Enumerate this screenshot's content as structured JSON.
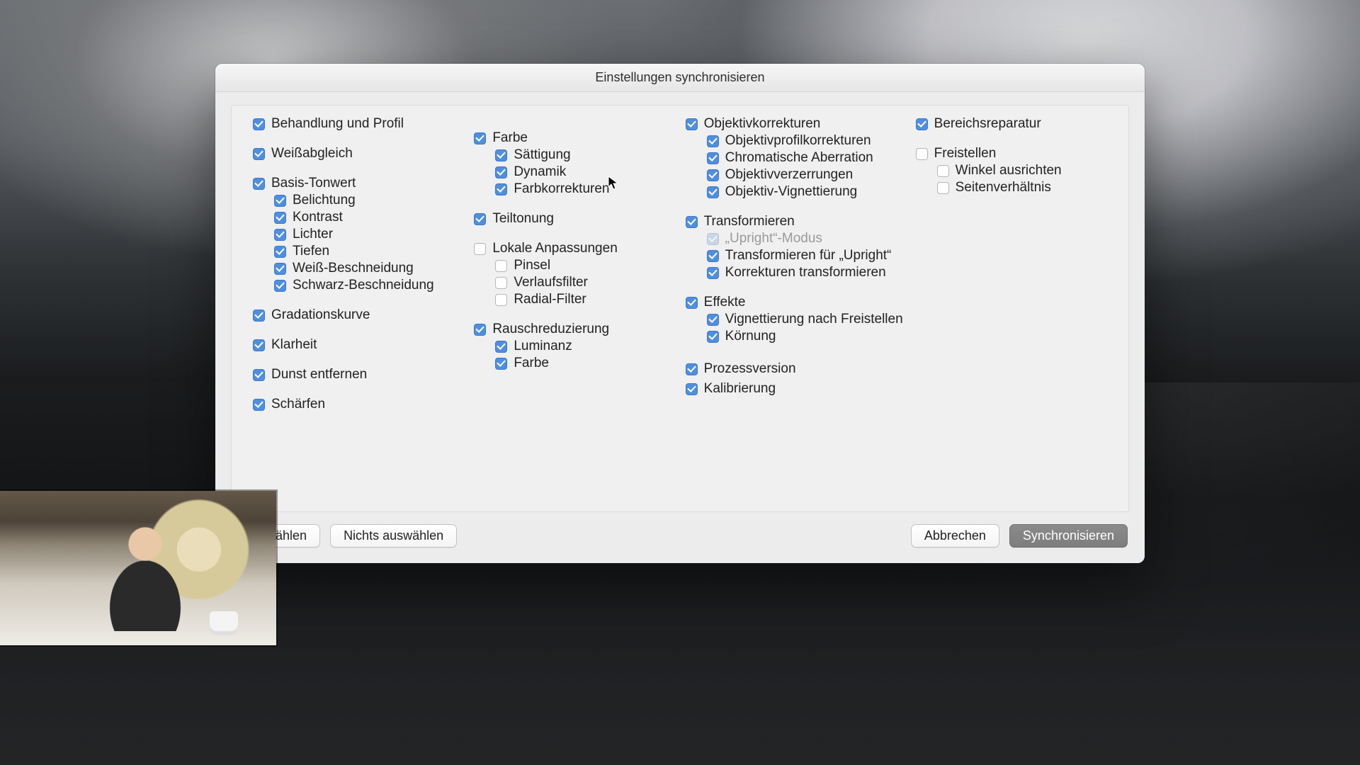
{
  "dialog": {
    "title": "Einstellungen synchronisieren",
    "buttons": {
      "select_all": "auswählen",
      "select_none": "Nichts auswählen",
      "cancel": "Abbrechen",
      "sync": "Synchronisieren"
    }
  },
  "col1": {
    "treatment": {
      "checked": true,
      "label": "Behandlung und Profil"
    },
    "wb": {
      "checked": true,
      "label": "Weißabgleich"
    },
    "basic": {
      "checked": true,
      "label": "Basis-Tonwert",
      "children": [
        {
          "checked": true,
          "label": "Belichtung"
        },
        {
          "checked": true,
          "label": "Kontrast"
        },
        {
          "checked": true,
          "label": "Lichter"
        },
        {
          "checked": true,
          "label": "Tiefen"
        },
        {
          "checked": true,
          "label": "Weiß-Beschneidung"
        },
        {
          "checked": true,
          "label": "Schwarz-Beschneidung"
        }
      ]
    },
    "curve": {
      "checked": true,
      "label": "Gradationskurve"
    },
    "clarity": {
      "checked": true,
      "label": "Klarheit"
    },
    "dehaze": {
      "checked": true,
      "label": "Dunst entfernen"
    },
    "sharpen": {
      "checked": true,
      "label": "Schärfen"
    }
  },
  "col2": {
    "color": {
      "checked": true,
      "label": "Farbe",
      "children": [
        {
          "checked": true,
          "label": "Sättigung"
        },
        {
          "checked": true,
          "label": "Dynamik"
        },
        {
          "checked": true,
          "label": "Farbkorrekturen"
        }
      ]
    },
    "split": {
      "checked": true,
      "label": "Teiltonung"
    },
    "local": {
      "checked": false,
      "label": "Lokale Anpassungen",
      "children": [
        {
          "checked": false,
          "label": "Pinsel"
        },
        {
          "checked": false,
          "label": "Verlaufsfilter"
        },
        {
          "checked": false,
          "label": "Radial-Filter"
        }
      ]
    },
    "noise": {
      "checked": true,
      "label": "Rauschreduzierung",
      "children": [
        {
          "checked": true,
          "label": "Luminanz"
        },
        {
          "checked": true,
          "label": "Farbe"
        }
      ]
    }
  },
  "col3": {
    "lens": {
      "checked": true,
      "label": "Objektivkorrekturen",
      "children": [
        {
          "checked": true,
          "label": "Objektivprofilkorrekturen"
        },
        {
          "checked": true,
          "label": "Chromatische Aberration"
        },
        {
          "checked": true,
          "label": "Objektivverzerrungen"
        },
        {
          "checked": true,
          "label": "Objektiv-Vignettierung"
        }
      ]
    },
    "transform": {
      "checked": true,
      "label": "Transformieren",
      "children": [
        {
          "checked": true,
          "disabled": true,
          "label": "„Upright“-Modus"
        },
        {
          "checked": true,
          "label": "Transformieren für „Upright“"
        },
        {
          "checked": true,
          "label": "Korrekturen transformieren"
        }
      ]
    },
    "effects": {
      "checked": true,
      "label": "Effekte",
      "children": [
        {
          "checked": true,
          "label": "Vignettierung nach Freistellen"
        },
        {
          "checked": true,
          "label": "Körnung"
        }
      ]
    },
    "pv": {
      "checked": true,
      "label": "Prozessversion"
    },
    "calib": {
      "checked": true,
      "label": "Kalibrierung"
    }
  },
  "col4": {
    "spot": {
      "checked": true,
      "label": "Bereichsreparatur"
    },
    "crop": {
      "checked": false,
      "label": "Freistellen",
      "children": [
        {
          "checked": false,
          "label": "Winkel ausrichten"
        },
        {
          "checked": false,
          "label": "Seitenverhältnis"
        }
      ]
    }
  }
}
